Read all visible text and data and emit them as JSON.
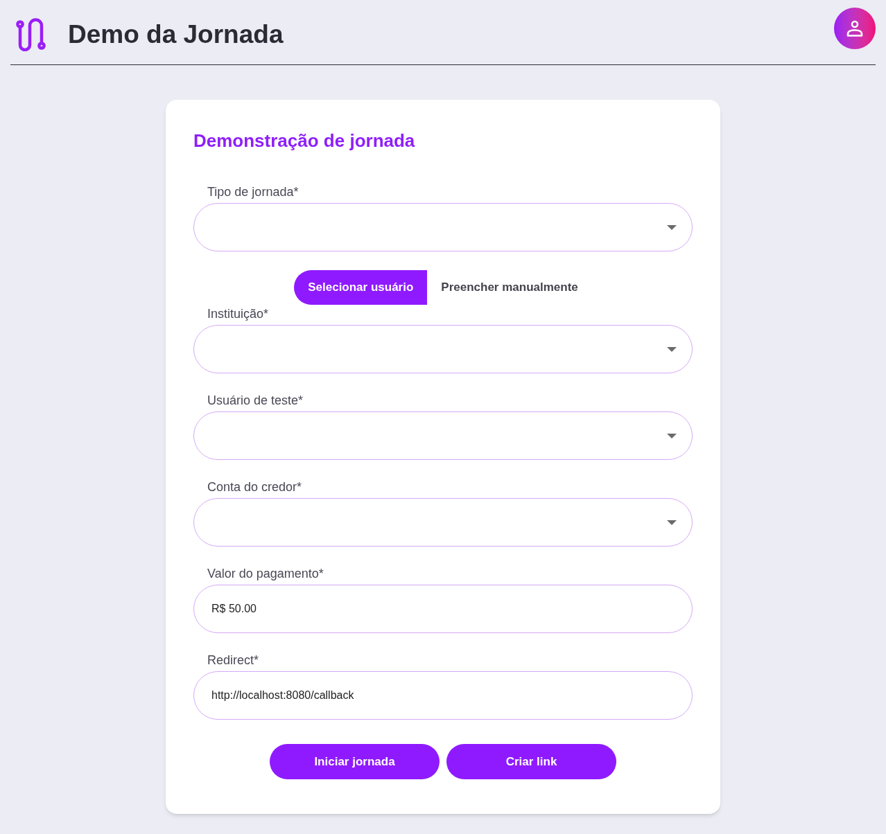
{
  "header": {
    "title": "Demo da Jornada"
  },
  "card": {
    "title": "Demonstração de jornada",
    "items": [
      {
        "kind": "select",
        "label": "Tipo de jornada*"
      },
      {
        "kind": "toggle",
        "options": [
          {
            "label": "Selecionar usuário",
            "selected": true
          },
          {
            "label": "Preencher manualmente",
            "selected": false
          }
        ]
      },
      {
        "kind": "select",
        "label": "Instituição*"
      },
      {
        "kind": "select",
        "label": "Usuário de teste*"
      },
      {
        "kind": "select",
        "label": "Conta do credor*"
      },
      {
        "kind": "text",
        "label": "Valor do pagamento*",
        "value": "R$ 50.00"
      },
      {
        "kind": "text",
        "label": "Redirect*",
        "value": "http://localhost:8080/callback"
      }
    ],
    "buttons": [
      {
        "label": "Iniciar jornada"
      },
      {
        "label": "Criar link"
      }
    ]
  }
}
